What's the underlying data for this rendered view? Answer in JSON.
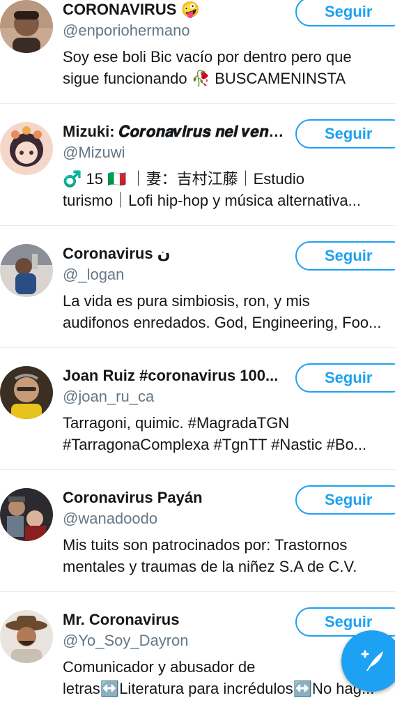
{
  "follow_label": "Seguir",
  "users": [
    {
      "name": "CORONAVIRUS 🤪",
      "handle": "@enporiohermano",
      "bio": [
        "Soy ese boli Bic vacío por dentro pero que",
        "sigue funcionando 🥀 BUSCAMENINSTA"
      ]
    },
    {
      "name": "Mizuki: 𝑪𝒐𝒓𝒐𝒏𝒂𝒗𝒊𝒓𝒖𝒔 𝒏𝒆𝒍 𝒗𝒆𝒏𝒆𝒕𝒐",
      "handle": "@Mizuwi",
      "bio": [
        "♂️ 15 🇮🇹 ｜妻：吉村江藤｜Estudio",
        "turismo｜Lofi hip-hop y música alternativa..."
      ]
    },
    {
      "name": "Coronavirus ن",
      "handle": "@_logan",
      "bio": [
        "La vida es pura simbiosis, ron, y mis",
        "audifonos enredados. God, Engineering, Foo..."
      ]
    },
    {
      "name": "Joan Ruiz #coronavirus 100...",
      "handle": "@joan_ru_ca",
      "bio": [
        "Tarragoni, quimic. #MagradaTGN",
        "#TarragonaComplexa #TgnTT #Nastic #Bo..."
      ]
    },
    {
      "name": "Coronavirus Payán",
      "handle": "@wanadoodo",
      "bio": [
        "Mis tuits son patrocinados por: Trastornos",
        "mentales y traumas de la niñez S.A de C.V."
      ]
    },
    {
      "name": "Mr. Coronavirus",
      "handle": "@Yo_Soy_Dayron",
      "bio": [
        "Comunicador y abusador de",
        "letras↔️Literatura para incrédulos↔️No hag..."
      ]
    }
  ],
  "fab": {
    "icon": "compose-tweet-icon"
  },
  "colors": {
    "accent": "#1da1f2",
    "secondary_text": "#657786",
    "divider": "#e6ecf0"
  }
}
